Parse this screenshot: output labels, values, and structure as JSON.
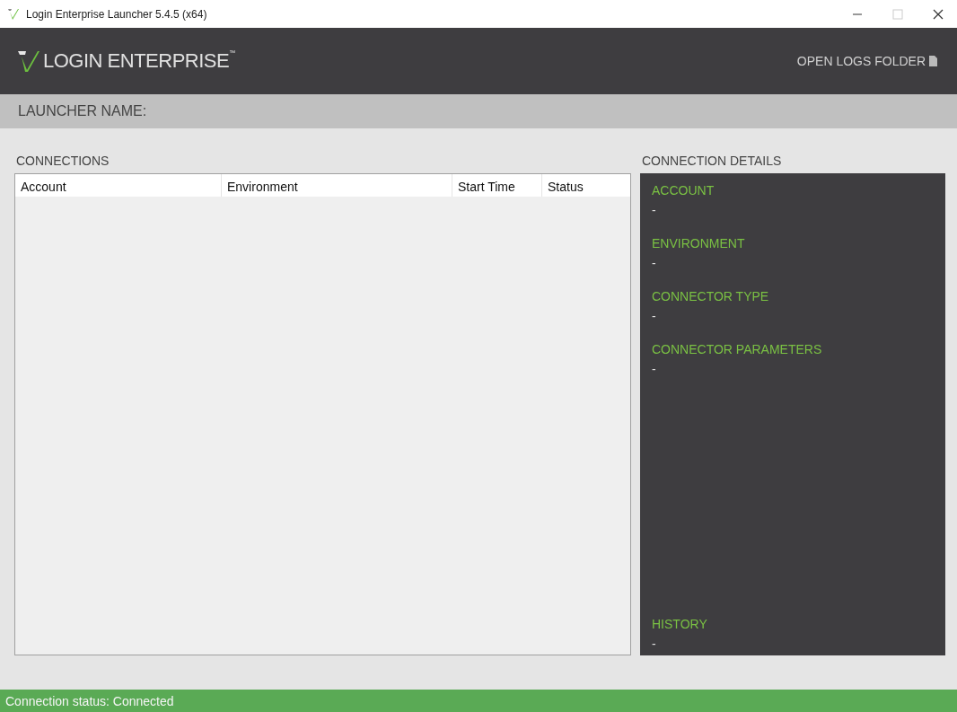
{
  "window": {
    "title": "Login Enterprise Launcher 5.4.5 (x64)"
  },
  "header": {
    "logo_text": "LOGIN ENTERPRISE$^{™}$",
    "open_logs_button": "OPEN LOGS FOLDER"
  },
  "launcher_name": {
    "label": "LAUNCHER NAME:"
  },
  "connections": {
    "title": "CONNECTIONS",
    "table": {
      "columns": [
        "Account",
        "Environment",
        "Start Time",
        "Status"
      ]
    }
  },
  "connection_details": {
    "title": "CONNECTION DETAILS",
    "fields": [
      {
        "label": "ACCOUNT",
        "value": "-"
      },
      {
        "label": "ENVIRONMENT",
        "value": "-"
      },
      {
        "label": "CONNECTOR TYPE",
        "value": "-"
      },
      {
        "label": "CONNECTOR PARAMETERS",
        "value": "-"
      }
    ],
    "history": {
      "label": "HISTORY",
      "value": "-"
    }
  },
  "status_bar": {
    "text": "Connection status: Connected"
  }
}
